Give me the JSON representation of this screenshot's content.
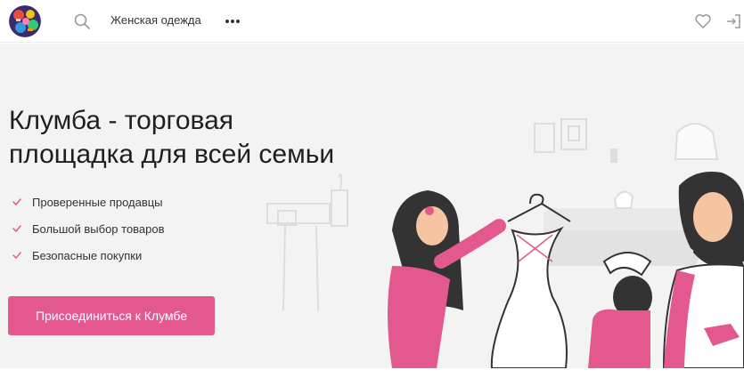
{
  "header": {
    "category_label": "Женская одежда",
    "icons": {
      "search": "search-icon",
      "more": "more-dots-icon",
      "favorites": "heart-icon",
      "login": "login-icon"
    }
  },
  "hero": {
    "title_line1": "Клумба - торговая",
    "title_line2": "площадка для всей семьи",
    "features": [
      "Проверенные продавцы",
      "Большой выбор товаров",
      "Безопасные покупки"
    ],
    "cta_label": "Присоединиться к Клумбе"
  },
  "colors": {
    "accent": "#e3588e",
    "hero_bg": "#f3f3f3",
    "text": "#1f1f1f"
  }
}
